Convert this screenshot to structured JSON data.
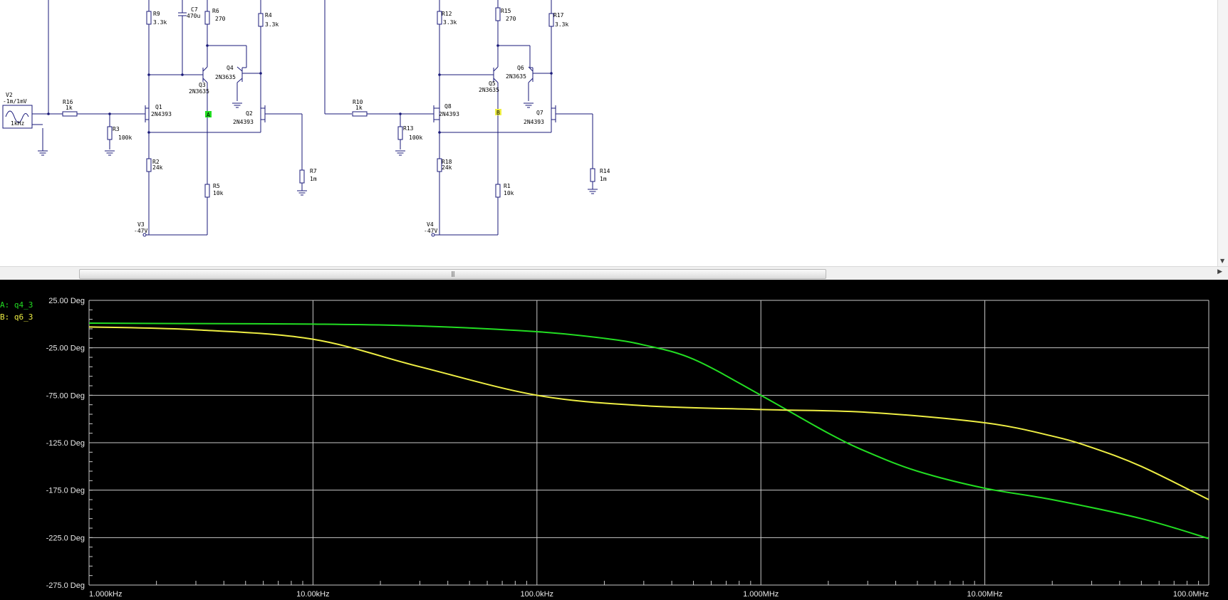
{
  "schematic": {
    "source": {
      "name": "V2",
      "value": "-1m/1mV",
      "freq": "1kHz"
    },
    "left_stage": {
      "R16": {
        "name": "R16",
        "value": "1k"
      },
      "R3": {
        "name": "R3",
        "value": "100k"
      },
      "R9": {
        "name": "R9",
        "value": "3.3k"
      },
      "C7": {
        "name": "C7",
        "value": "470u"
      },
      "R6": {
        "name": "R6",
        "value": "270"
      },
      "R4": {
        "name": "R4",
        "value": "3.3k"
      },
      "Q1": {
        "name": "Q1",
        "value": "2N4393"
      },
      "Q2": {
        "name": "Q2",
        "value": "2N4393"
      },
      "Q3": {
        "name": "Q3",
        "value": "2N3635"
      },
      "Q4": {
        "name": "Q4",
        "value": "2N3635"
      },
      "R2": {
        "name": "R2",
        "value": "24k"
      },
      "R5": {
        "name": "R5",
        "value": "10k"
      },
      "R7": {
        "name": "R7",
        "value": "1m"
      },
      "V3": {
        "name": "V3",
        "value": "-47V"
      },
      "probe": "A"
    },
    "right_stage": {
      "R10": {
        "name": "R10",
        "value": "1k"
      },
      "R13": {
        "name": "R13",
        "value": "100k"
      },
      "R12": {
        "name": "R12",
        "value": "3.3k"
      },
      "R15": {
        "name": "R15",
        "value": "270"
      },
      "R17": {
        "name": "R17",
        "value": "3.3k"
      },
      "Q8": {
        "name": "Q8",
        "value": "2N4393"
      },
      "Q7": {
        "name": "Q7",
        "value": "2N4393"
      },
      "Q5": {
        "name": "Q5",
        "value": "2N3635"
      },
      "Q6": {
        "name": "Q6",
        "value": "2N3635"
      },
      "R18": {
        "name": "R18",
        "value": "24k"
      },
      "R1": {
        "name": "R1",
        "value": "10k"
      },
      "R14": {
        "name": "R14",
        "value": "1m"
      },
      "V4": {
        "name": "V4",
        "value": "-47V"
      },
      "probe": "B"
    }
  },
  "legend": [
    {
      "label": "A: q4_3",
      "color": "#22dd22"
    },
    {
      "label": "B: q6_3",
      "color": "#eeee44"
    }
  ],
  "colors": {
    "wire": "#1a1a7a",
    "trace_a": "#22dd22",
    "trace_b": "#eeee44",
    "grid": "#c8c8c8",
    "axis_text": "#e8e8e8"
  },
  "chart_data": {
    "type": "line",
    "x_scale": "log",
    "xlim": [
      1000,
      100000000
    ],
    "ylim": [
      -275,
      25
    ],
    "y_ticks": [
      25,
      -25,
      -75,
      -125,
      -175,
      -225,
      -275
    ],
    "y_tick_labels": [
      "25.00 Deg",
      "-25.00 Deg",
      "-75.00 Deg",
      "-125.0 Deg",
      "-175.0 Deg",
      "-225.0 Deg",
      "-275.0 Deg"
    ],
    "x_ticks": [
      1000,
      10000,
      100000,
      1000000,
      10000000,
      100000000
    ],
    "x_tick_labels": [
      "1.000kHz",
      "10.00kHz",
      "100.0kHz",
      "1.000MHz",
      "10.00MHz",
      "100.0MHz"
    ],
    "grid": true,
    "legend": "top-left",
    "series": [
      {
        "name": "q4_3",
        "color": "#22dd22",
        "x": [
          1000,
          3000,
          10000,
          30000,
          100000,
          200000,
          300000,
          500000,
          1000000,
          2000000,
          3000000,
          5000000,
          10000000,
          20000000,
          50000000,
          100000000
        ],
        "y": [
          1,
          0.5,
          0,
          -2,
          -8,
          -15,
          -22,
          -37,
          -75,
          -115,
          -135,
          -155,
          -173,
          -185,
          -205,
          -226
        ]
      },
      {
        "name": "q6_3",
        "color": "#eeee44",
        "x": [
          1000,
          3000,
          10000,
          30000,
          100000,
          300000,
          1000000,
          3000000,
          10000000,
          20000000,
          30000000,
          50000000,
          100000000
        ],
        "y": [
          -3,
          -6,
          -16,
          -45,
          -75,
          -86,
          -90,
          -93,
          -104,
          -118,
          -130,
          -150,
          -185
        ]
      }
    ]
  }
}
